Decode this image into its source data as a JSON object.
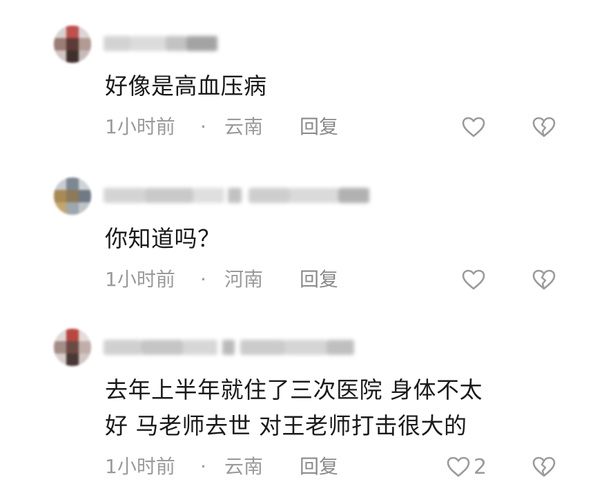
{
  "comments": [
    {
      "text": "好像是高血压病",
      "time": "1小时前",
      "separator": "·",
      "location": "云南",
      "reply_label": "回复",
      "like_count": "",
      "like_icon": "heart-outline-icon",
      "dislike_icon": "broken-heart-icon"
    },
    {
      "text": "你知道吗？",
      "time": "1小时前",
      "separator": "·",
      "location": "河南",
      "reply_label": "回复",
      "like_count": "",
      "like_icon": "heart-outline-icon",
      "dislike_icon": "broken-heart-icon"
    },
    {
      "text_lines": [
        "去年上半年就住了三次医院 身体不太",
        "好 马老师去世 对王老师打击很大的"
      ],
      "time": "1小时前",
      "separator": "·",
      "location": "云南",
      "reply_label": "回复",
      "like_count": "2",
      "like_icon": "heart-outline-icon",
      "dislike_icon": "broken-heart-icon"
    }
  ],
  "colors": {
    "text": "#1a1a1a",
    "meta": "#9a9a9a",
    "background": "#ffffff"
  }
}
